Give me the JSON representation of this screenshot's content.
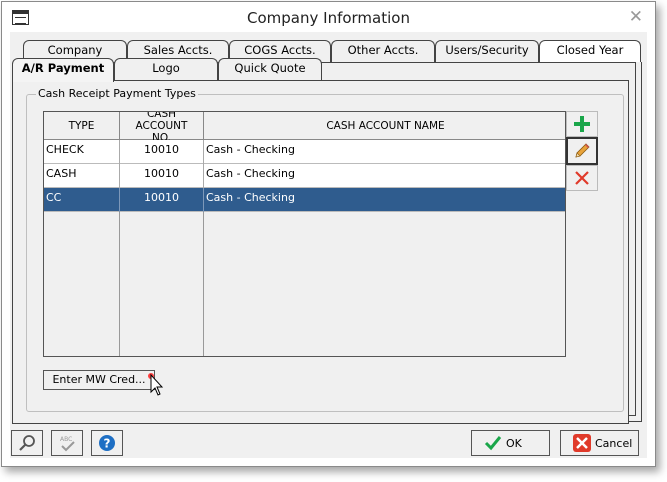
{
  "window": {
    "title": "Company Information"
  },
  "tabs_back": [
    {
      "label": "Company"
    },
    {
      "label": "Sales Accts."
    },
    {
      "label": "COGS Accts."
    },
    {
      "label": "Other Accts."
    },
    {
      "label": "Users/Security"
    },
    {
      "label": "Closed Year"
    }
  ],
  "tabs_front": [
    {
      "label": "A/R Payment",
      "active": true
    },
    {
      "label": "Logo"
    },
    {
      "label": "Quick Quote"
    }
  ],
  "group": {
    "title": "Cash Receipt Payment Types"
  },
  "grid": {
    "columns": [
      "TYPE",
      "CASH ACCOUNT NO.",
      "CASH ACCOUNT NAME"
    ],
    "rows": [
      {
        "type": "CHECK",
        "account_no": "10010",
        "account_name": "Cash - Checking",
        "selected": false
      },
      {
        "type": "CASH",
        "account_no": "10010",
        "account_name": "Cash - Checking",
        "selected": false
      },
      {
        "type": "CC",
        "account_no": "10010",
        "account_name": "Cash - Checking",
        "selected": true
      }
    ]
  },
  "buttons": {
    "enter_mw_cred": "Enter MW Cred...",
    "ok": "OK",
    "cancel": "Cancel"
  },
  "icons": [
    "app-icon",
    "close-icon",
    "add-icon",
    "edit-pencil-icon",
    "delete-x-icon",
    "search-icon",
    "spell-check-icon",
    "help-icon",
    "checkmark-icon",
    "cancel-x-icon"
  ],
  "colors": {
    "selected_row": "#2f5c8e",
    "add_green": "#1aa64a",
    "delete_red": "#e03a2a",
    "help_blue": "#1e6fc4"
  }
}
